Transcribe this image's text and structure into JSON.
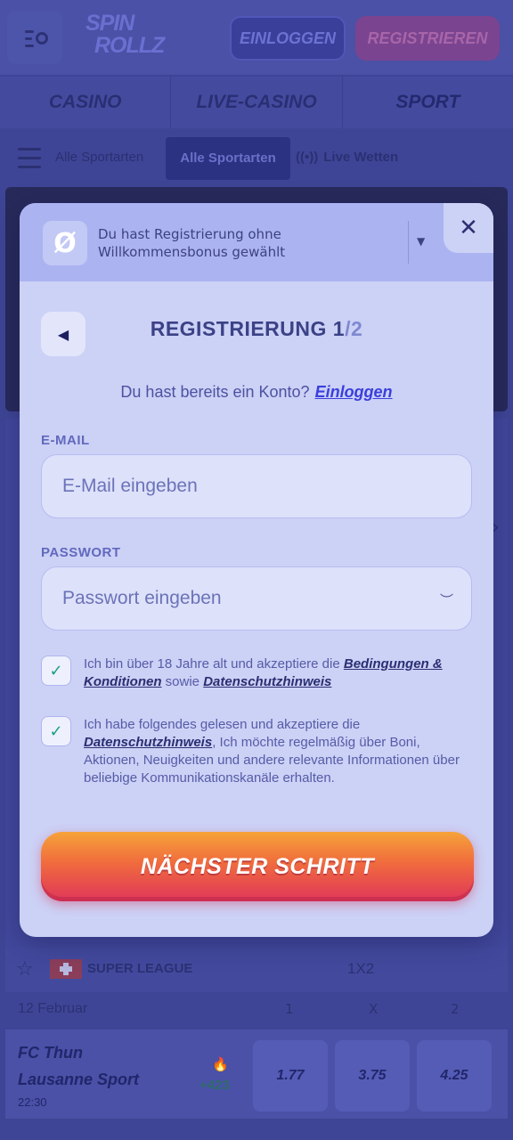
{
  "header": {
    "logo_line1": "SPIN",
    "logo_line2": "ROLLZ",
    "login_label": "EINLOGGEN",
    "register_label": "REGISTRIEREN"
  },
  "category_tabs": [
    {
      "label": "CASINO"
    },
    {
      "label": "LIVE-CASINO"
    },
    {
      "label": "SPORT"
    }
  ],
  "sport_nav": {
    "all_sports": "Alle Sportarten",
    "all_sports_active": "Alle Sportarten",
    "live_bets": "Live Wetten"
  },
  "league": {
    "name": "SUPER LEAGUE",
    "market": "1X2",
    "date": "12 Februar",
    "col1": "1",
    "colx": "X",
    "col2": "2"
  },
  "match": {
    "team1": "FC Thun",
    "team2": "Lausanne Sport",
    "time": "22:30",
    "more_markets": "+423",
    "odds": [
      "1.77",
      "3.75",
      "4.25"
    ]
  },
  "modal": {
    "bonus_text": "Du hast Registrierung ohne Willkommensbonus gewählt",
    "title_main": "REGISTRIERUNG 1",
    "title_slash": "/",
    "title_step": "2",
    "have_account": "Du hast bereits ein Konto?",
    "login_link": "Einloggen",
    "email_label": "E-MAIL",
    "email_placeholder": "E-Mail eingeben",
    "password_label": "PASSWORT",
    "password_placeholder": "Passwort eingeben",
    "terms_text_1": "Ich bin über 18 Jahre alt und akzeptiere die",
    "terms_link": "Bedingungen & Konditionen",
    "terms_text_2": "sowie",
    "privacy_link_1": "Datenschutzhinweis",
    "marketing_text_1": "Ich habe folgendes gelesen und akzeptiere die",
    "privacy_link_2": "Datenschutzhinweis",
    "marketing_text_2": ", Ich möchte regelmäßig über Boni, Aktionen, Neuigkeiten und andere relevante Informationen über beliebige Kommunikationskanäle erhalten.",
    "terms_checked": true,
    "marketing_checked": true,
    "next_label": "NÄCHSTER SCHRITT"
  },
  "colors": {
    "overlay": "#3f4596",
    "modal_bg": "#ccd1f6",
    "accent_link": "#3a3fdc",
    "button_gradient_top": "#f6a33a",
    "button_gradient_bottom": "#e0365a",
    "check_green": "#18a083"
  },
  "icons": {
    "menu_search": "menu-search-icon",
    "no_bonus": "no-bonus-icon",
    "close": "close-icon",
    "back": "back-arrow-icon",
    "eye": "eye-closed-icon",
    "check": "check-icon"
  }
}
